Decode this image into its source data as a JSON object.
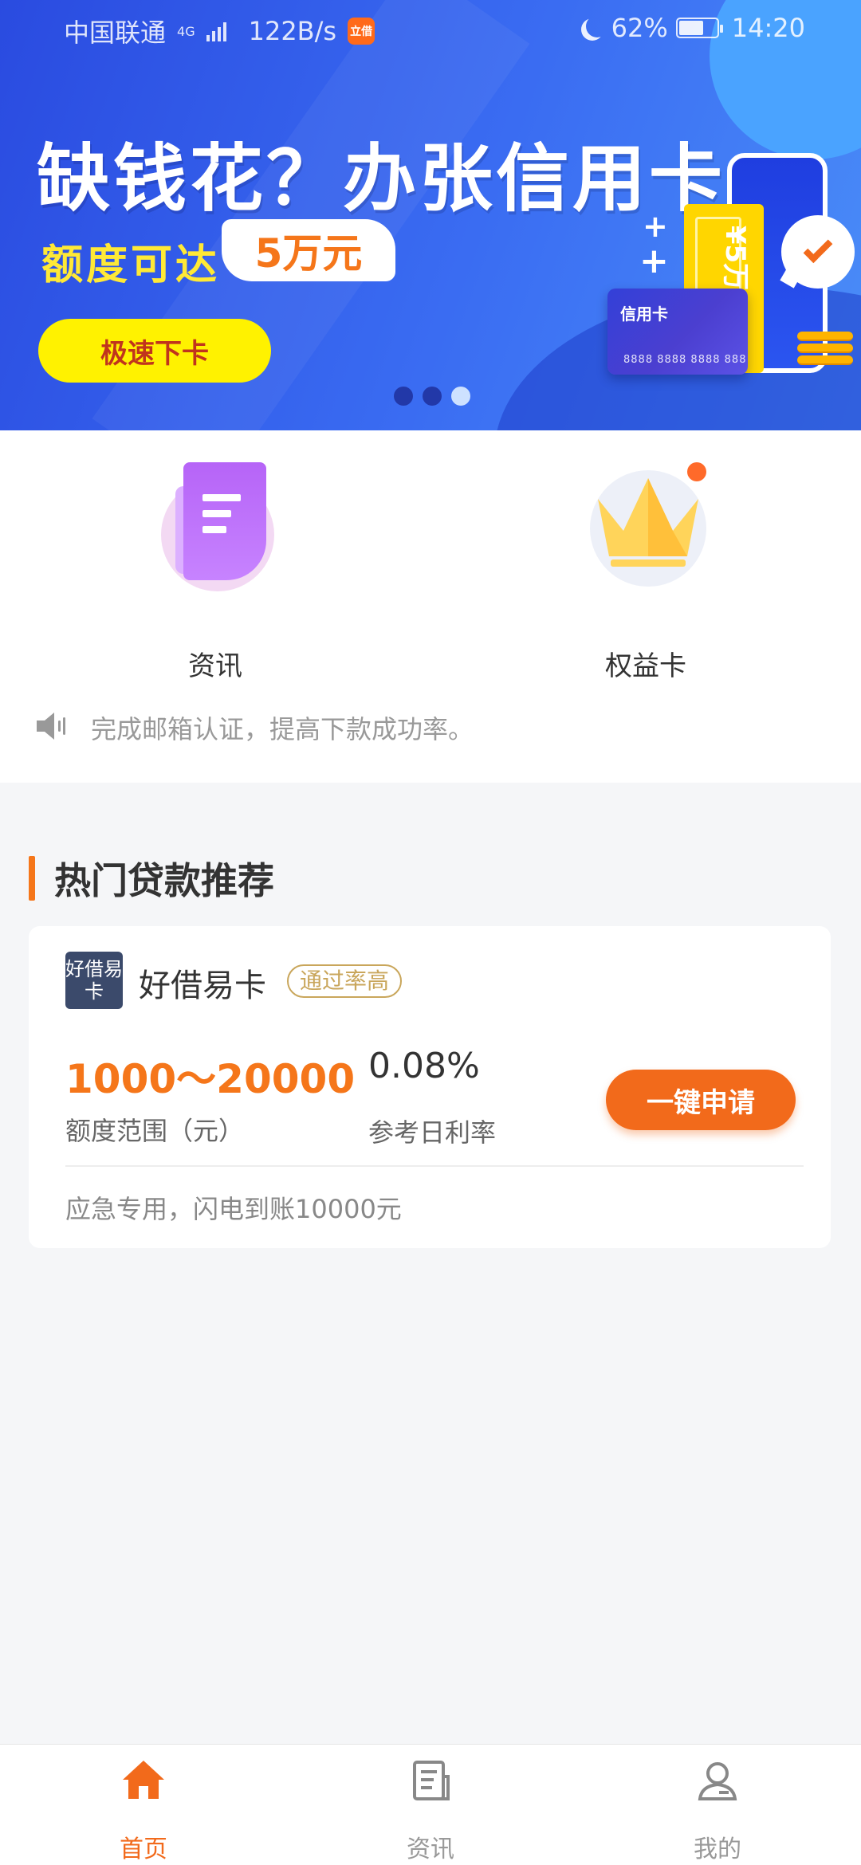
{
  "status_bar": {
    "carrier": "中国联通",
    "network": "4G",
    "speed": "122B/s",
    "app_badge": "立借",
    "battery": "62%",
    "time": "14:20"
  },
  "banner": {
    "headline": "缺钱花？办张信用卡",
    "subtitle_prefix": "额度可达",
    "subtitle_amount": "5万元",
    "button_label": "极速下卡",
    "ticket_text": "¥5万元",
    "card_title": "信用卡",
    "card_number": "8888 8888 8888 888",
    "carousel_index": 3,
    "carousel_count": 3
  },
  "quick_menu": [
    {
      "label": "资讯",
      "icon": "document-icon"
    },
    {
      "label": "权益卡",
      "icon": "crown-icon"
    }
  ],
  "notice": {
    "icon": "speaker-icon",
    "text": "完成邮箱认证，提高下款成功率。"
  },
  "hot_loans": {
    "title": "热门贷款推荐",
    "items": [
      {
        "logo_text": "好借易卡",
        "name": "好借易卡",
        "tag": "通过率高",
        "amount_range": "1000～20000",
        "amount_label": "额度范围（元）",
        "rate": "0.08%",
        "rate_label": "参考日利率",
        "apply_label": "一键申请",
        "description": "应急专用，闪电到账10000元"
      }
    ]
  },
  "tabbar": [
    {
      "label": "首页",
      "icon": "home-icon",
      "active": true
    },
    {
      "label": "资讯",
      "icon": "news-icon",
      "active": false
    },
    {
      "label": "我的",
      "icon": "user-icon",
      "active": false
    }
  ],
  "colors": {
    "accent": "#f26a1b",
    "banner_blue": "#3a6cf2",
    "banner_yellow": "#fff200"
  }
}
